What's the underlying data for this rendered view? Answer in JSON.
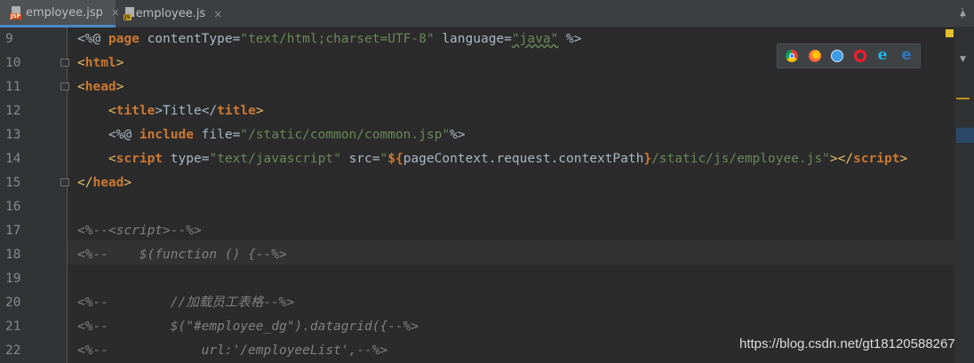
{
  "tabs": [
    {
      "label": "employee.jsp",
      "icon_tag": "JSP",
      "active": true,
      "close": "×"
    },
    {
      "label": "employee.js",
      "icon_tag": "JS",
      "active": false,
      "close": "×"
    }
  ],
  "tab_menu_glyph": "⋮",
  "line_numbers": [
    "9",
    "10",
    "11",
    "12",
    "13",
    "14",
    "15",
    "16",
    "17",
    "18",
    "19",
    "20",
    "21",
    "22"
  ],
  "code": {
    "l9": {
      "a": "<%@ ",
      "b": "page",
      "c": " contentType=",
      "d": "\"text/html;charset=UTF-8\"",
      "e": " language=",
      "f": "\"java\"",
      "g": " %>"
    },
    "l10": {
      "a": "<",
      "b": "html",
      "c": ">"
    },
    "l11": {
      "a": "<",
      "b": "head",
      "c": ">"
    },
    "l12": {
      "indent": "    ",
      "a": "<",
      "b": "title",
      "c": ">Title</",
      "d": "title",
      "e": ">"
    },
    "l13": {
      "indent": "    ",
      "a": "<%@ ",
      "b": "include",
      "c": " file=",
      "d": "\"/static/common/common.jsp\"",
      "e": "%>"
    },
    "l14": {
      "indent": "    ",
      "a": "<",
      "b": "script",
      "c": " type=",
      "d": "\"text/javascript\"",
      "e": " src=",
      "f": "\"",
      "g": "${",
      "h": "pageContext.request.contextPath",
      "i": "}",
      "j": "/static/js/employee.js\"",
      "k": "></",
      "l": "script",
      "m": ">"
    },
    "l15": {
      "a": "</",
      "b": "head",
      "c": ">"
    },
    "l17": "<%--<script>--%>",
    "l18": "<%--    $(function () {--%>",
    "l20": "<%--        //加载员工表格--%>",
    "l21": "<%--        $(\"#employee_dg\").datagrid({--%>",
    "l22": "<%--            url:'/employeeList',--%>"
  },
  "browser_icons": [
    "chrome-icon",
    "firefox-icon",
    "safari-icon",
    "opera-icon",
    "ie-icon",
    "edge-icon"
  ],
  "colors": {
    "background": "#2b2b2b",
    "keyword": "#cc7832",
    "string": "#6a8759",
    "tag": "#e8bf6a",
    "comment": "#808080"
  },
  "watermark": "https://blog.csdn.net/gt18120588267"
}
